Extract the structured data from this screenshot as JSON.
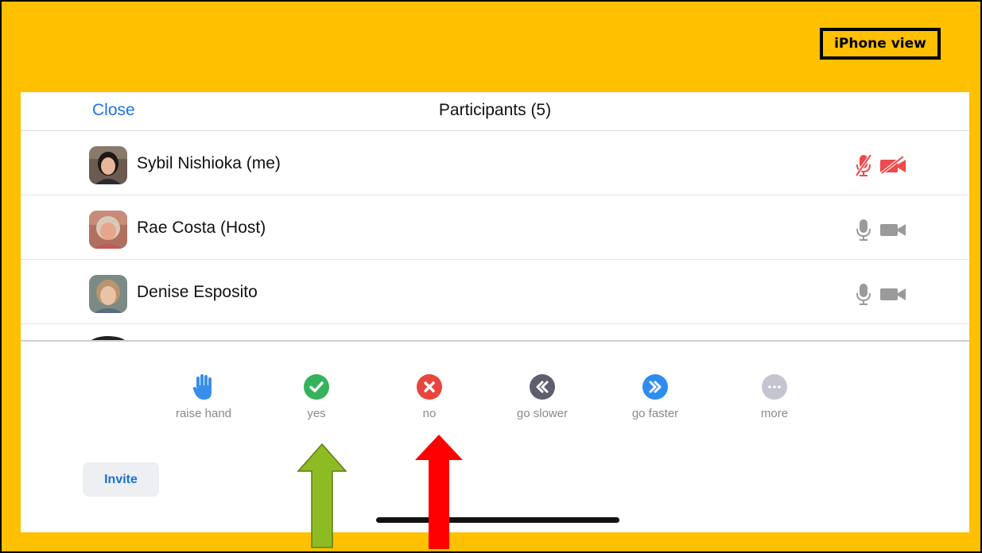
{
  "tag": {
    "text": "iPhone view"
  },
  "header": {
    "close_label": "Close",
    "title": "Participants (5)"
  },
  "participants": [
    {
      "name": "Sybil Nishioka (me)",
      "mic": "muted",
      "video": "off",
      "icon_color": "#F04A4A"
    },
    {
      "name": "Rae Costa (Host)",
      "mic": "on",
      "video": "on",
      "icon_color": "#9a9a9a"
    },
    {
      "name": "Denise Esposito",
      "mic": "on",
      "video": "on",
      "icon_color": "#9a9a9a"
    }
  ],
  "feedback": [
    {
      "label": "raise hand",
      "icon": "raised-hand-icon",
      "color": "#3A8EEA"
    },
    {
      "label": "yes",
      "icon": "checkmark-icon",
      "color": "#34B35A"
    },
    {
      "label": "no",
      "icon": "x-icon",
      "color": "#E8453C"
    },
    {
      "label": "go slower",
      "icon": "rewind-icon",
      "color": "#5D5E6E"
    },
    {
      "label": "go faster",
      "icon": "fast-forward-icon",
      "color": "#2D8CF0"
    },
    {
      "label": "more",
      "icon": "more-dots-icon",
      "color": "#C5C5D2"
    }
  ],
  "invite": {
    "label": "Invite"
  },
  "annotations": {
    "green_arrow_color": "#8DBB24",
    "red_arrow_color": "#FF0000",
    "frame_color": "#FFC000"
  }
}
